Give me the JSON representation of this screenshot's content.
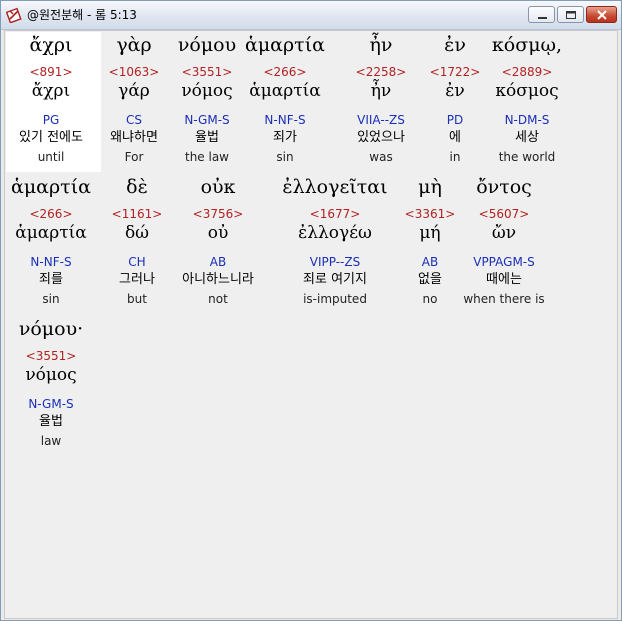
{
  "window": {
    "title": "@원전분해 - 롬 5:13"
  },
  "words": [
    {
      "greek": "ἄχρι",
      "strong": "<891>",
      "lemma": "ἄχρι",
      "parse": "PG",
      "korean": "있기 전에도",
      "english": "until"
    },
    {
      "greek": "γὰρ",
      "strong": "<1063>",
      "lemma": "γάρ",
      "parse": "CS",
      "korean": "왜냐하면",
      "english": "For"
    },
    {
      "greek": "νόμου",
      "strong": "<3551>",
      "lemma": "νόμος",
      "parse": "N-GM-S",
      "korean": "율법",
      "english": "the law"
    },
    {
      "greek": "ἁμαρτία",
      "strong": "<266>",
      "lemma": "ἁμαρτία",
      "parse": "N-NF-S",
      "korean": "죄가",
      "english": "sin"
    },
    {
      "greek": "ἦν",
      "strong": "<2258>",
      "lemma": "ἦν",
      "parse": "VIIA--ZS",
      "korean": "있었으나",
      "english": "was"
    },
    {
      "greek": "ἐν",
      "strong": "<1722>",
      "lemma": "ἐν",
      "parse": "PD",
      "korean": "에",
      "english": "in"
    },
    {
      "greek": "κόσμῳ,",
      "strong": "<2889>",
      "lemma": "κόσμος",
      "parse": "N-DM-S",
      "korean": "세상",
      "english": "the world"
    },
    {
      "greek": "ἁμαρτία",
      "strong": "<266>",
      "lemma": "ἁμαρτία",
      "parse": "N-NF-S",
      "korean": "죄를",
      "english": "sin"
    },
    {
      "greek": "δὲ",
      "strong": "<1161>",
      "lemma": "δώ",
      "parse": "CH",
      "korean": "그러나",
      "english": "but"
    },
    {
      "greek": "οὐκ",
      "strong": "<3756>",
      "lemma": "οὐ",
      "parse": "AB",
      "korean": "아니하느니라",
      "english": "not"
    },
    {
      "greek": "ἐλλογεῖται",
      "strong": "<1677>",
      "lemma": "ἐλλογέω",
      "parse": "VIPP--ZS",
      "korean": "죄로 여기지",
      "english": "is-imputed"
    },
    {
      "greek": "μὴ",
      "strong": "<3361>",
      "lemma": "μή",
      "parse": "AB",
      "korean": "없을",
      "english": "no"
    },
    {
      "greek": "ὄντος",
      "strong": "<5607>",
      "lemma": "ὤν",
      "parse": "VPPAGM-S",
      "korean": "때에는",
      "english": "when there is"
    },
    {
      "greek": "νόμου·",
      "strong": "<3551>",
      "lemma": "νόμος",
      "parse": "N-GM-S",
      "korean": "율법",
      "english": "law"
    }
  ]
}
